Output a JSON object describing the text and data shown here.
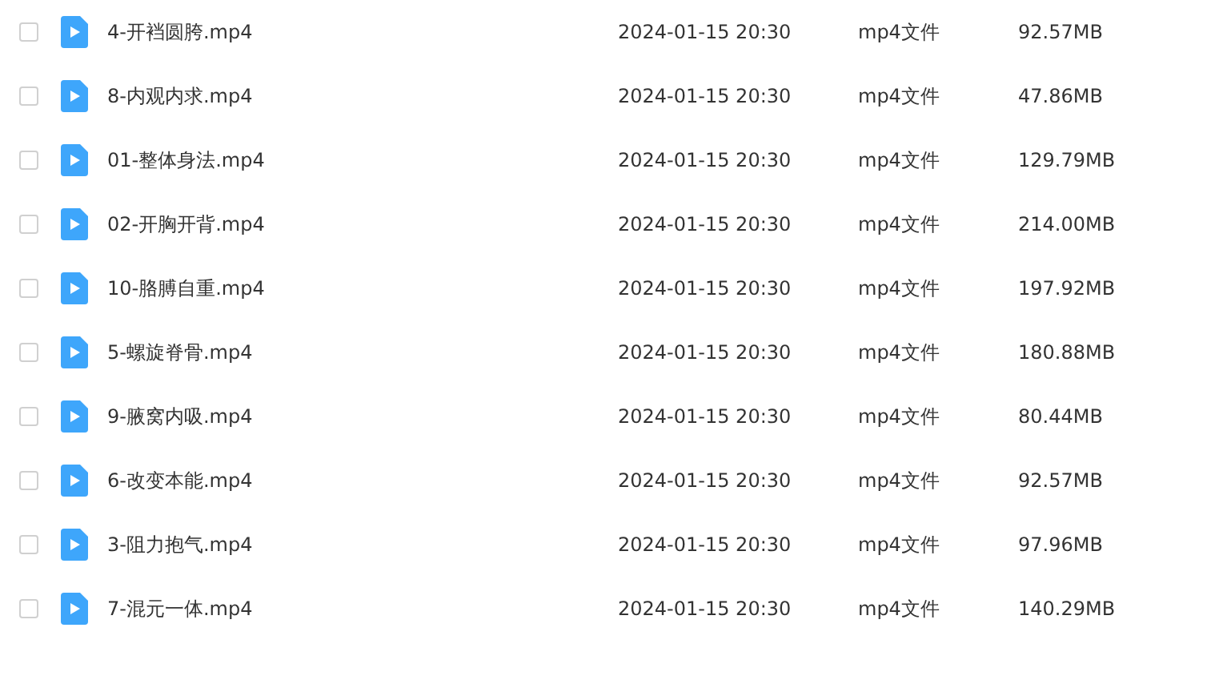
{
  "files": [
    {
      "name": "4-开裆圆胯.mp4",
      "modified": "2024-01-15 20:30",
      "type": "mp4文件",
      "size": "92.57MB",
      "checked": false
    },
    {
      "name": "8-内观内求.mp4",
      "modified": "2024-01-15 20:30",
      "type": "mp4文件",
      "size": "47.86MB",
      "checked": false
    },
    {
      "name": "01-整体身法.mp4",
      "modified": "2024-01-15 20:30",
      "type": "mp4文件",
      "size": "129.79MB",
      "checked": false
    },
    {
      "name": "02-开胸开背.mp4",
      "modified": "2024-01-15 20:30",
      "type": "mp4文件",
      "size": "214.00MB",
      "checked": false
    },
    {
      "name": "10-胳膊自重.mp4",
      "modified": "2024-01-15 20:30",
      "type": "mp4文件",
      "size": "197.92MB",
      "checked": false
    },
    {
      "name": "5-螺旋脊骨.mp4",
      "modified": "2024-01-15 20:30",
      "type": "mp4文件",
      "size": "180.88MB",
      "checked": false
    },
    {
      "name": "9-腋窝内吸.mp4",
      "modified": "2024-01-15 20:30",
      "type": "mp4文件",
      "size": "80.44MB",
      "checked": false
    },
    {
      "name": "6-改变本能.mp4",
      "modified": "2024-01-15 20:30",
      "type": "mp4文件",
      "size": "92.57MB",
      "checked": false
    },
    {
      "name": "3-阻力抱气.mp4",
      "modified": "2024-01-15 20:30",
      "type": "mp4文件",
      "size": "97.96MB",
      "checked": false
    },
    {
      "name": "7-混元一体.mp4",
      "modified": "2024-01-15 20:30",
      "type": "mp4文件",
      "size": "140.29MB",
      "checked": false
    }
  ]
}
